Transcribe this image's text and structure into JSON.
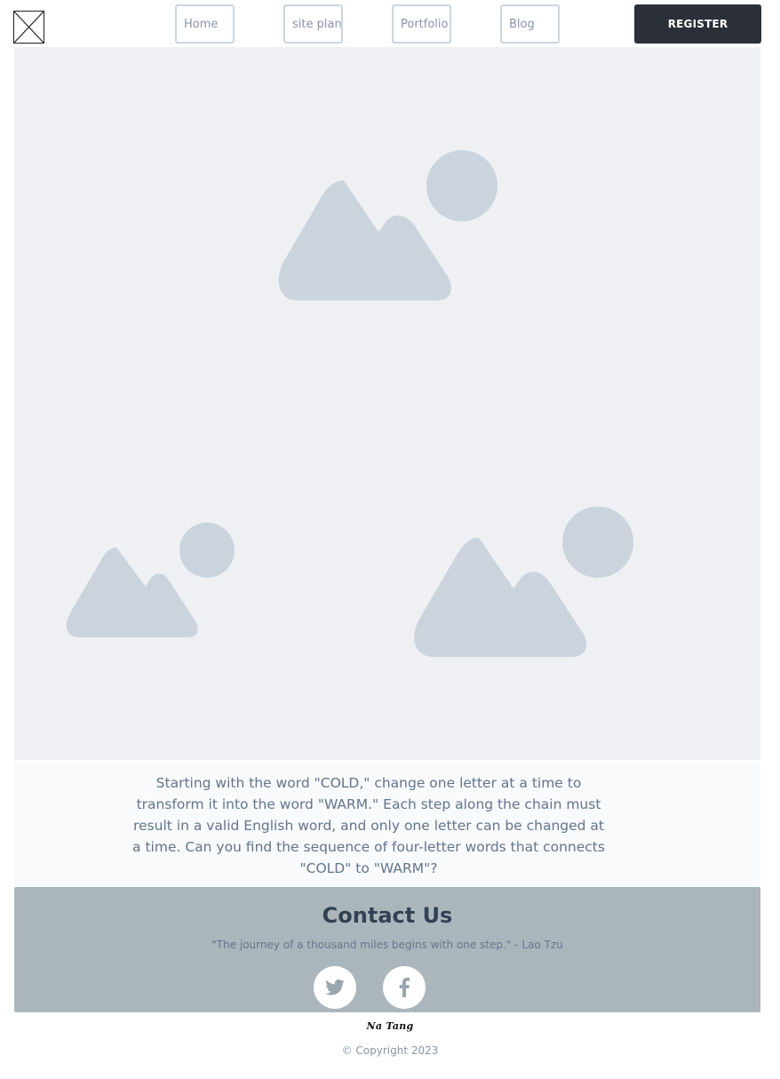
{
  "header": {
    "logo_icon": "broken-image-placeholder-icon",
    "nav": [
      {
        "label": "Home"
      },
      {
        "label": "site plan"
      },
      {
        "label": "Portfolio"
      },
      {
        "label": "Blog"
      }
    ],
    "register_label": "REGISTER"
  },
  "hero": {
    "images": [
      {
        "icon": "image-placeholder-icon"
      },
      {
        "icon": "image-placeholder-icon"
      },
      {
        "icon": "image-placeholder-icon"
      }
    ],
    "placeholder_color": "#cbd3dc",
    "background_color": "#eef0f4"
  },
  "puzzle": {
    "text": "Starting with the word \"COLD,\" change one letter at a time to transform it into the word \"WARM.\" Each step along the chain must result in a valid English word, and only one letter can be changed at a time. Can you find the sequence of four-letter words that connects \"COLD\" to \"WARM\"?"
  },
  "contact": {
    "title": "Contact Us",
    "quote": "\"The journey of a thousand miles begins with one step.\" - Lao Tzu",
    "social": [
      {
        "icon": "twitter-icon"
      },
      {
        "icon": "facebook-icon"
      }
    ],
    "background_color": "#abb6bc"
  },
  "footer": {
    "signature": "Na Tang",
    "copyright": "© Copyright 2023"
  },
  "colors": {
    "register_bg": "#2b3038",
    "nav_border": "#cbd5e1"
  }
}
